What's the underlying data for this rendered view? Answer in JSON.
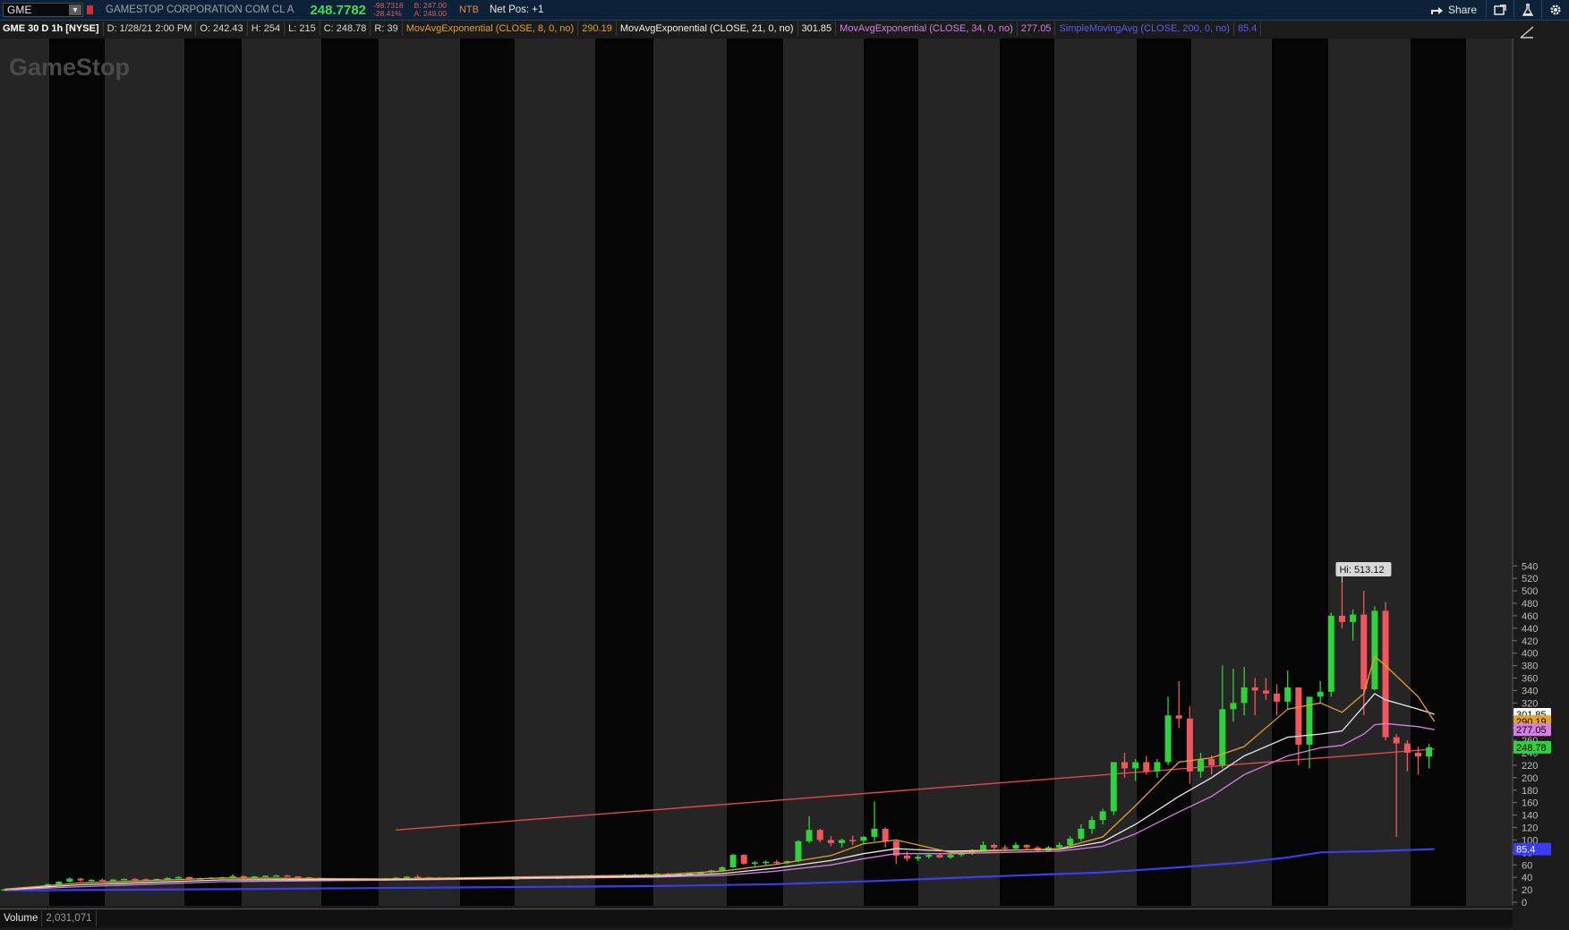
{
  "header": {
    "symbol": "GME",
    "company": "GAMESTOP CORPORATION COM CL A",
    "last": "248.7782",
    "change": "-98.7318",
    "change_pct": "-28.41%",
    "bid": "B: 247.00",
    "ask": "A: 249.00",
    "ntb": "NTB",
    "net_pos": "Net Pos: +1",
    "share_label": "Share"
  },
  "info": {
    "symbol": "GME 30 D 1h [NYSE]",
    "date": "D: 1/28/21 2:00 PM",
    "open": "O: 242.43",
    "high": "H: 254",
    "low": "L: 215",
    "close": "C: 248.78",
    "range": "R: 39",
    "ema8_label": "MovAvgExponential (CLOSE, 8, 0, no)",
    "ema8_value": "290.19",
    "ema21_label": "MovAvgExponential (CLOSE, 21, 0, no)",
    "ema21_value": "301.85",
    "ema34_label": "MovAvgExponential (CLOSE, 34, 0, no)",
    "ema34_value": "277.05",
    "sma200_label": "SimpleMovingAvg (CLOSE, 200, 0, no)",
    "sma200_value": "85.4"
  },
  "volume": {
    "label": "Volume",
    "value": "2,031,071"
  },
  "colors": {
    "up": "#2ed23c",
    "down": "#f0575c",
    "ema8": "#e3a126",
    "ema21": "#e8e8e8",
    "ema34": "#d67ee6",
    "sma200": "#3b3bf0",
    "trendline": "#e0484b",
    "band_light": "#2e2e2e",
    "band_dark": "#050505"
  },
  "chart_data": {
    "type": "candlestick",
    "watermark": "GameStop",
    "y_ticks": [
      0,
      20,
      40,
      60,
      80,
      100,
      120,
      140,
      160,
      180,
      200,
      220,
      240,
      260,
      280,
      300,
      320,
      340,
      360,
      380,
      400,
      420,
      440,
      460,
      480,
      500,
      520,
      540
    ],
    "ylim": [
      0,
      545
    ],
    "hi_label": "Hi: 513.12",
    "price_tags": [
      {
        "text": "301.85",
        "value": 301.85,
        "series": "ema21"
      },
      {
        "text": "290.19",
        "value": 290.19,
        "series": "ema8"
      },
      {
        "text": "277.05",
        "value": 277.05,
        "series": "ema34"
      },
      {
        "text": "248.78",
        "value": 248.78,
        "series": "last"
      },
      {
        "text": "85.4",
        "value": 85.4,
        "series": "sma200"
      }
    ],
    "candles": [
      [
        20.5,
        21.2,
        19.8,
        20.8
      ],
      [
        20.8,
        22,
        20.5,
        21.6
      ],
      [
        21.6,
        23.5,
        21.2,
        23
      ],
      [
        23,
        26,
        22.5,
        25.5
      ],
      [
        25.5,
        30,
        25,
        29
      ],
      [
        29,
        34,
        28,
        33
      ],
      [
        33,
        40,
        32,
        38
      ],
      [
        38,
        39,
        33,
        35
      ],
      [
        35,
        37,
        33,
        36
      ],
      [
        36,
        38,
        34,
        35.5
      ],
      [
        35.5,
        37,
        34,
        36.5
      ],
      [
        36.5,
        38,
        35.5,
        37.5
      ],
      [
        37.5,
        39,
        36,
        37
      ],
      [
        37,
        38,
        35.5,
        36
      ],
      [
        36,
        38,
        35,
        37.5
      ],
      [
        37.5,
        40,
        36.5,
        39
      ],
      [
        39,
        42,
        38,
        40.5
      ],
      [
        40.5,
        41,
        37,
        38
      ],
      [
        38,
        39.5,
        36.5,
        38.5
      ],
      [
        38.5,
        40.5,
        37.5,
        39.5
      ],
      [
        39.5,
        41,
        38,
        40
      ],
      [
        40,
        45,
        39.5,
        42
      ],
      [
        42,
        43,
        39,
        40
      ],
      [
        40,
        42,
        38.5,
        41.5
      ],
      [
        41.5,
        43,
        40,
        42.5
      ],
      [
        42.5,
        44,
        41,
        43
      ],
      [
        43,
        44,
        41,
        41.5
      ],
      [
        41.5,
        42,
        39,
        40
      ],
      [
        40,
        41,
        38,
        39
      ],
      [
        39,
        40,
        36.5,
        37.5
      ],
      [
        37.5,
        38,
        35.5,
        36
      ],
      [
        36,
        38,
        35,
        37
      ],
      [
        37,
        38.5,
        36,
        38
      ],
      [
        38,
        39,
        36.5,
        37
      ],
      [
        37,
        38,
        36,
        37.5
      ],
      [
        37.5,
        39,
        36.5,
        38.5
      ],
      [
        38.5,
        40.5,
        37.5,
        39.5
      ],
      [
        39.5,
        42,
        38.5,
        41
      ],
      [
        41,
        44,
        39,
        40
      ],
      [
        40,
        41,
        38,
        39.5
      ],
      [
        39.5,
        40.5,
        38,
        39
      ],
      [
        39,
        40,
        37.5,
        38.5
      ],
      [
        38.5,
        39.5,
        37.5,
        38.5
      ],
      [
        38.5,
        40,
        37.5,
        39.5
      ],
      [
        39.5,
        41,
        38,
        38.5
      ],
      [
        38.5,
        40,
        37.5,
        39
      ],
      [
        39,
        40,
        37.5,
        38
      ],
      [
        38,
        39.5,
        37,
        38.5
      ],
      [
        38.5,
        40,
        37.5,
        39.5
      ],
      [
        39.5,
        41,
        38.5,
        40
      ],
      [
        40,
        41,
        38.5,
        39
      ],
      [
        39,
        40,
        38,
        39.5
      ],
      [
        39.5,
        41,
        38.5,
        40.5
      ],
      [
        40.5,
        42,
        39.5,
        41.5
      ],
      [
        41.5,
        44,
        40.5,
        43
      ],
      [
        43,
        44,
        41,
        41.5
      ],
      [
        41.5,
        43,
        40.5,
        42.5
      ],
      [
        42.5,
        45,
        41.5,
        44
      ],
      [
        44,
        46,
        43,
        44.5
      ],
      [
        44.5,
        46,
        43,
        45
      ],
      [
        45,
        47,
        44,
        46
      ],
      [
        46,
        47,
        44,
        44.5
      ],
      [
        44.5,
        46,
        43.5,
        45.5
      ],
      [
        45.5,
        47,
        44.5,
        46.5
      ],
      [
        46.5,
        49,
        45.5,
        48
      ],
      [
        48,
        52,
        47,
        51
      ],
      [
        51,
        58,
        50,
        56
      ],
      [
        56,
        78,
        55,
        76
      ],
      [
        76,
        77,
        60,
        62
      ],
      [
        62,
        66,
        58,
        64
      ],
      [
        64,
        67,
        60,
        65
      ],
      [
        65,
        68,
        61,
        63
      ],
      [
        63,
        67,
        61,
        66
      ],
      [
        66,
        100,
        64,
        98
      ],
      [
        98,
        138,
        95,
        116
      ],
      [
        116,
        118,
        96,
        100
      ],
      [
        100,
        106,
        90,
        95
      ],
      [
        95,
        102,
        88,
        100
      ],
      [
        100,
        107,
        92,
        99
      ],
      [
        99,
        106,
        93,
        105
      ],
      [
        105,
        162,
        98,
        118
      ],
      [
        118,
        120,
        88,
        98
      ],
      [
        98,
        100,
        62,
        75
      ],
      [
        75,
        82,
        66,
        70
      ],
      [
        70,
        76,
        66,
        73
      ],
      [
        73,
        79,
        70,
        76
      ],
      [
        76,
        78,
        71,
        72
      ],
      [
        72,
        78,
        70,
        76
      ],
      [
        76,
        80,
        73,
        78
      ],
      [
        78,
        85,
        76,
        84
      ],
      [
        84,
        98,
        82,
        92
      ],
      [
        92,
        94,
        84,
        88
      ],
      [
        88,
        92,
        83,
        86
      ],
      [
        86,
        96,
        85,
        92
      ],
      [
        92,
        93,
        85,
        88
      ],
      [
        88,
        90,
        81,
        83
      ],
      [
        83,
        90,
        81,
        88
      ],
      [
        88,
        96,
        86,
        92
      ],
      [
        92,
        106,
        90,
        102
      ],
      [
        102,
        125,
        98,
        118
      ],
      [
        118,
        138,
        110,
        132
      ],
      [
        132,
        150,
        125,
        146
      ],
      [
        146,
        195,
        140,
        225
      ],
      [
        225,
        240,
        200,
        215
      ],
      [
        215,
        230,
        195,
        225
      ],
      [
        225,
        235,
        205,
        210
      ],
      [
        210,
        230,
        200,
        225
      ],
      [
        225,
        330,
        220,
        300
      ],
      [
        300,
        355,
        280,
        295
      ],
      [
        295,
        315,
        190,
        210
      ],
      [
        210,
        240,
        200,
        230
      ],
      [
        230,
        236,
        205,
        220
      ],
      [
        220,
        380,
        215,
        310
      ],
      [
        310,
        375,
        290,
        320
      ],
      [
        320,
        378,
        300,
        345
      ],
      [
        345,
        360,
        300,
        340
      ],
      [
        340,
        360,
        325,
        335
      ],
      [
        335,
        350,
        300,
        322
      ],
      [
        322,
        372,
        310,
        345
      ],
      [
        345,
        340,
        220,
        253
      ],
      [
        253,
        320,
        215,
        330
      ],
      [
        330,
        355,
        320,
        338
      ],
      [
        338,
        465,
        330,
        460
      ],
      [
        460,
        513,
        440,
        450
      ],
      [
        450,
        470,
        420,
        462
      ],
      [
        462,
        500,
        300,
        342
      ],
      [
        342,
        475,
        340,
        468
      ],
      [
        468,
        482,
        260,
        265
      ],
      [
        265,
        270,
        105,
        255
      ],
      [
        255,
        260,
        210,
        240
      ],
      [
        240,
        250,
        205,
        234
      ],
      [
        234,
        254,
        215,
        248.78
      ]
    ],
    "trendline": {
      "from": [
        36,
        116
      ],
      "to": [
        131.5,
        246
      ]
    },
    "ema8_anchors": [
      [
        0,
        21
      ],
      [
        7,
        31
      ],
      [
        20,
        39
      ],
      [
        35,
        37.5
      ],
      [
        60,
        44
      ],
      [
        66,
        50
      ],
      [
        71,
        61
      ],
      [
        76,
        75
      ],
      [
        79,
        94
      ],
      [
        82,
        100
      ],
      [
        87,
        80
      ],
      [
        97,
        86
      ],
      [
        101,
        105
      ],
      [
        104,
        155
      ],
      [
        108,
        225
      ],
      [
        111,
        232
      ],
      [
        114,
        250
      ],
      [
        118,
        310
      ],
      [
        121,
        320
      ],
      [
        123,
        305
      ],
      [
        125,
        335
      ],
      [
        126,
        395
      ],
      [
        127,
        380
      ],
      [
        130,
        330
      ],
      [
        131.5,
        290.19
      ]
    ],
    "ema21_anchors": [
      [
        0,
        20.5
      ],
      [
        7,
        28
      ],
      [
        20,
        36
      ],
      [
        35,
        36.5
      ],
      [
        60,
        42
      ],
      [
        66,
        46
      ],
      [
        71,
        55
      ],
      [
        76,
        67
      ],
      [
        79,
        78
      ],
      [
        82,
        86
      ],
      [
        87,
        82
      ],
      [
        97,
        85
      ],
      [
        101,
        97
      ],
      [
        104,
        125
      ],
      [
        108,
        170
      ],
      [
        111,
        200
      ],
      [
        114,
        235
      ],
      [
        118,
        265
      ],
      [
        121,
        270
      ],
      [
        123,
        275
      ],
      [
        125,
        315
      ],
      [
        126,
        335
      ],
      [
        127,
        325
      ],
      [
        130,
        310
      ],
      [
        131.5,
        301.85
      ]
    ],
    "ema34_anchors": [
      [
        0,
        20
      ],
      [
        7,
        25
      ],
      [
        20,
        33
      ],
      [
        35,
        35.5
      ],
      [
        60,
        40.5
      ],
      [
        66,
        43
      ],
      [
        71,
        50
      ],
      [
        76,
        60
      ],
      [
        79,
        70
      ],
      [
        82,
        78
      ],
      [
        87,
        78
      ],
      [
        97,
        82
      ],
      [
        101,
        90
      ],
      [
        104,
        110
      ],
      [
        108,
        145
      ],
      [
        111,
        170
      ],
      [
        114,
        205
      ],
      [
        118,
        235
      ],
      [
        121,
        248
      ],
      [
        123,
        252
      ],
      [
        125,
        270
      ],
      [
        126,
        285
      ],
      [
        127,
        287
      ],
      [
        130,
        282
      ],
      [
        131.5,
        277.05
      ]
    ],
    "sma200_anchors": [
      [
        0,
        19
      ],
      [
        20,
        21
      ],
      [
        40,
        23.5
      ],
      [
        60,
        26
      ],
      [
        71,
        29
      ],
      [
        80,
        34
      ],
      [
        90,
        41
      ],
      [
        101,
        48
      ],
      [
        108,
        56
      ],
      [
        114,
        64
      ],
      [
        118,
        72
      ],
      [
        121,
        80
      ],
      [
        126,
        82
      ],
      [
        131.5,
        85.4
      ]
    ]
  }
}
